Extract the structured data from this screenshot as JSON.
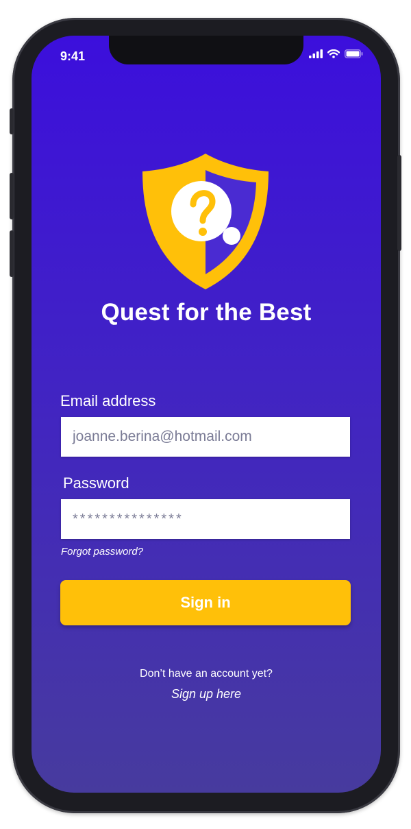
{
  "status_bar": {
    "time": "9:41",
    "icons": [
      "cellular-signal-icon",
      "wifi-icon",
      "battery-icon"
    ]
  },
  "app": {
    "title": "Quest for the Best",
    "logo_icon": "shield-question-icon"
  },
  "form": {
    "email_label": "Email address",
    "email_value": "joanne.berina@hotmail.com",
    "password_label": "Password",
    "password_value": "***************",
    "forgot_password": "Forgot password?",
    "signin_label": "Sign in"
  },
  "footer": {
    "no_account": "Don’t have an account yet?",
    "signup_link": "Sign up here"
  },
  "colors": {
    "background_top": "#3c0fdc",
    "background_bottom": "#473b9e",
    "accent_yellow": "#ffc009",
    "field_text": "#7a7b95"
  }
}
